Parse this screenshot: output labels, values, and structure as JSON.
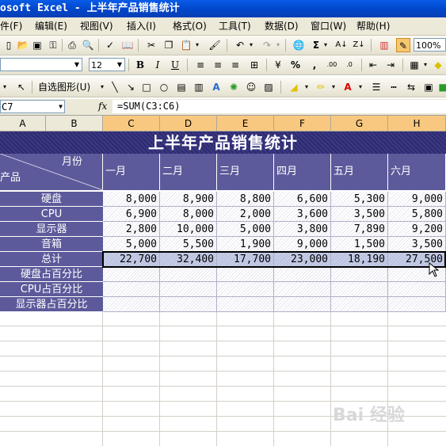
{
  "window": {
    "title": "osoft Excel - 上半年产品销售统计"
  },
  "menu": [
    "件(F)",
    "编辑(E)",
    "视图(V)",
    "插入(I)",
    "格式(O)",
    "工具(T)",
    "数据(D)",
    "窗口(W)",
    "帮助(H)"
  ],
  "toolbar": {
    "zoom": "100%",
    "font_size": "12",
    "draw_shapes": "自选图形(U)"
  },
  "formula_bar": {
    "name_box": "C7",
    "fx": "fx",
    "formula": "=SUM(C3:C6)"
  },
  "columns": [
    "A",
    "B",
    "C",
    "D",
    "E",
    "F",
    "G",
    "H"
  ],
  "sheet": {
    "banner": "上半年产品销售统计",
    "header_month_label": "月份",
    "header_product_label": "产品",
    "months": [
      "一月",
      "二月",
      "三月",
      "四月",
      "五月",
      "六月"
    ],
    "rows": [
      {
        "label": "硬盘",
        "values": [
          "8,000",
          "8,900",
          "8,800",
          "6,600",
          "5,300",
          "9,000"
        ]
      },
      {
        "label": "CPU",
        "values": [
          "6,900",
          "8,000",
          "2,000",
          "3,600",
          "3,500",
          "5,800"
        ]
      },
      {
        "label": "显示器",
        "values": [
          "2,800",
          "10,000",
          "5,000",
          "3,800",
          "7,890",
          "9,200"
        ]
      },
      {
        "label": "音箱",
        "values": [
          "5,000",
          "5,500",
          "1,900",
          "9,000",
          "1,500",
          "3,500"
        ]
      },
      {
        "label": "总计",
        "values": [
          "22,700",
          "32,400",
          "17,700",
          "23,000",
          "18,190",
          "27,500"
        ]
      },
      {
        "label": "硬盘占百分比",
        "values": [
          "",
          "",
          "",
          "",
          "",
          ""
        ]
      },
      {
        "label": "CPU占百分比",
        "values": [
          "",
          "",
          "",
          "",
          "",
          ""
        ]
      },
      {
        "label": "显示器占百分比",
        "values": [
          "",
          "",
          "",
          "",
          "",
          ""
        ]
      }
    ]
  },
  "watermark": "Bai 经验"
}
